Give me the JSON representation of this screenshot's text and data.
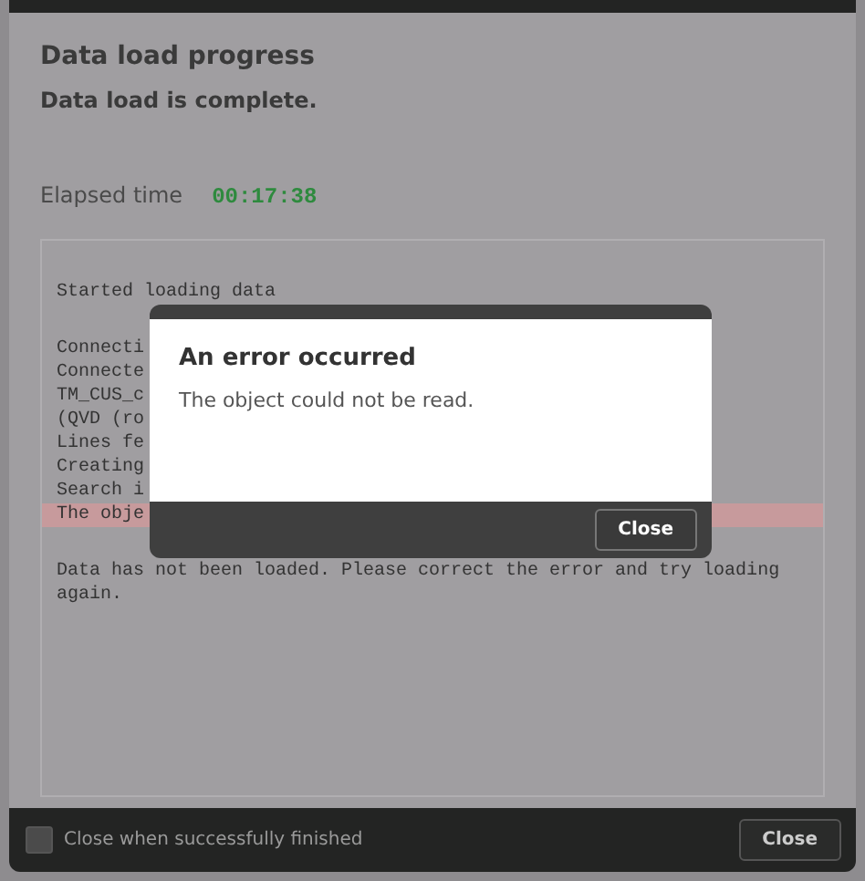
{
  "dialog": {
    "title": "Data load progress",
    "status": "Data load is complete.",
    "elapsed_label": "Elapsed time",
    "elapsed_value": "00:17:38",
    "log": [
      {
        "text": "Started loading data",
        "kind": "normal"
      },
      {
        "kind": "blank"
      },
      {
        "text": "Connecti",
        "kind": "normal"
      },
      {
        "text": "Connecte",
        "kind": "normal"
      },
      {
        "text": "TM_CUS_c",
        "kind": "normal"
      },
      {
        "text": "(QVD (ro",
        "kind": "normal"
      },
      {
        "text": "Lines fe",
        "kind": "normal"
      },
      {
        "text": "Creating",
        "kind": "normal"
      },
      {
        "text": "Search i",
        "kind": "normal"
      },
      {
        "text": "The obje",
        "kind": "error"
      },
      {
        "kind": "blank"
      },
      {
        "text": "Data has not been loaded. Please correct the error and try loading again.",
        "kind": "normal"
      }
    ],
    "close_when_finished": {
      "label": "Close when successfully finished",
      "checked": false
    },
    "close_button": "Close"
  },
  "error_modal": {
    "title": "An error occurred",
    "message": "The object could not be read.",
    "close_button": "Close"
  }
}
